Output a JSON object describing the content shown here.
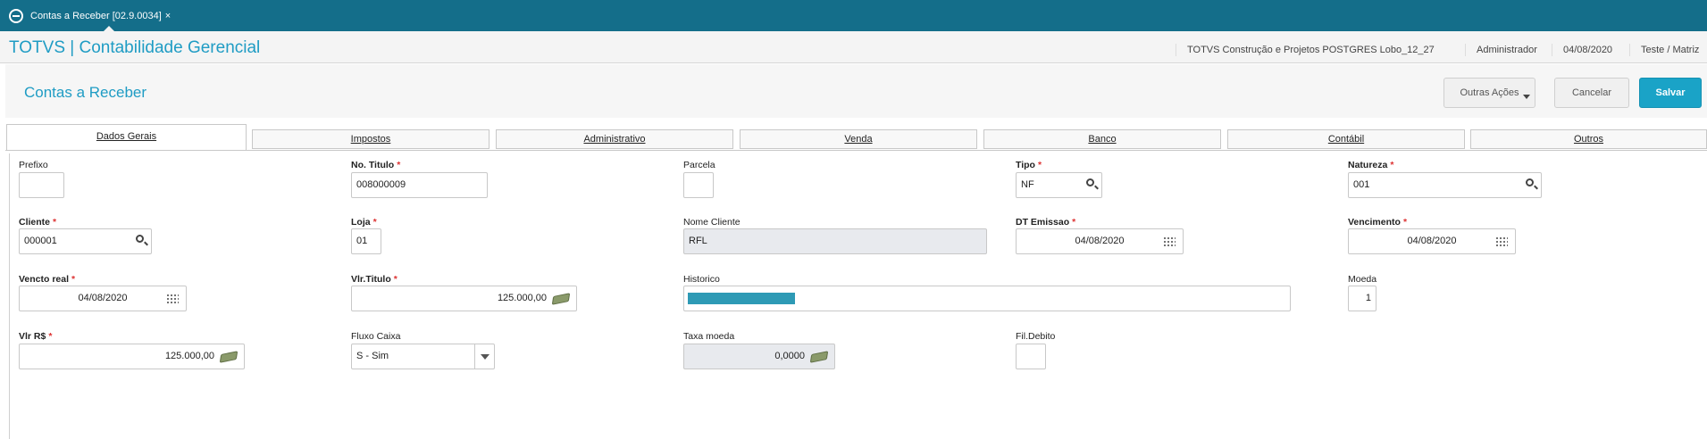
{
  "topbar": {
    "tab_label": "Contas a Receber [02.9.0034]",
    "tab_close": "×"
  },
  "header": {
    "app_title": "TOTVS | Contabilidade Gerencial",
    "company": "TOTVS Construção e Projetos POSTGRES Lobo_12_27",
    "user": "Administrador",
    "date": "04/08/2020",
    "branch": "Teste / Matriz"
  },
  "page": {
    "title": "Contas a Receber"
  },
  "actions": {
    "more": "Outras Ações",
    "cancel": "Cancelar",
    "save": "Salvar"
  },
  "tabs": [
    "Dados Gerais",
    "Impostos",
    "Administrativo",
    "Venda",
    "Banco",
    "Contábil",
    "Outros"
  ],
  "fields": {
    "prefixo": {
      "label": "Prefixo",
      "value": ""
    },
    "titulo": {
      "label": "No. Titulo",
      "value": "008000009"
    },
    "parcela": {
      "label": "Parcela",
      "value": ""
    },
    "tipo": {
      "label": "Tipo",
      "value": "NF"
    },
    "natureza": {
      "label": "Natureza",
      "value": "001"
    },
    "cliente": {
      "label": "Cliente",
      "value": "000001"
    },
    "loja": {
      "label": "Loja",
      "value": "01"
    },
    "nome_cliente": {
      "label": "Nome Cliente",
      "value": "RFL"
    },
    "dt_emissao": {
      "label": "DT Emissao",
      "value": "04/08/2020"
    },
    "vencimento": {
      "label": "Vencimento",
      "value": "04/08/2020"
    },
    "vencto_real": {
      "label": "Vencto real",
      "value": "04/08/2020"
    },
    "vlr_titulo": {
      "label": "Vlr.Titulo",
      "value": "125.000,00"
    },
    "historico": {
      "label": "Historico",
      "value": ""
    },
    "moeda": {
      "label": "Moeda",
      "value": "1"
    },
    "vlr_rs": {
      "label": "Vlr R$",
      "value": "125.000,00"
    },
    "fluxo_caixa": {
      "label": "Fluxo Caixa",
      "value": "S - Sim"
    },
    "taxa_moeda": {
      "label": "Taxa moeda",
      "value": "0,0000"
    },
    "fil_debito": {
      "label": "Fil.Debito",
      "value": ""
    }
  },
  "required_mark": "*",
  "colors": {
    "topbar": "#146e8a",
    "accent": "#1f9cc4",
    "save": "#1aa3c7",
    "required": "#d33333"
  }
}
